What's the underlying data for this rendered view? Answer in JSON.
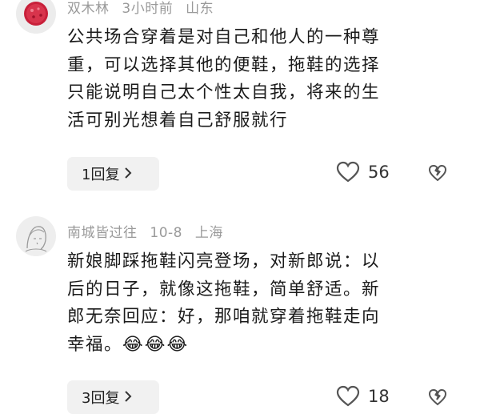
{
  "comments": [
    {
      "username": "双木林",
      "time": "3小时前",
      "location": "山东",
      "lines": [
        "公共场合穿着是对自己和他人的一种尊",
        "重，可以选择其他的便鞋，拖鞋的选择",
        "只能说明自己太个性太自我，将来的生",
        "活可别光想着自己舒服就行"
      ],
      "reply_label": "1回复",
      "likes": "56"
    },
    {
      "username": "南城皆过往",
      "time": "10-8",
      "location": "上海",
      "lines": [
        "新娘脚踩拖鞋闪亮登场，对新郎说：以",
        "后的日子，就像这拖鞋，简单舒适。新",
        "郎无奈回应：好，那咱就穿着拖鞋走向",
        "幸福。"
      ],
      "emojis": [
        "😂",
        "😂",
        "😂"
      ],
      "reply_label": "3回复",
      "likes": "18"
    }
  ],
  "icons": {
    "reply_chevron": "chevron-right-icon",
    "like": "heart-outline-icon",
    "dislike": "broken-heart-icon"
  },
  "colors": {
    "meta_text": "#9a9a9a",
    "reply_bg": "#f1f1f1",
    "avatar1": "#c8203a"
  }
}
